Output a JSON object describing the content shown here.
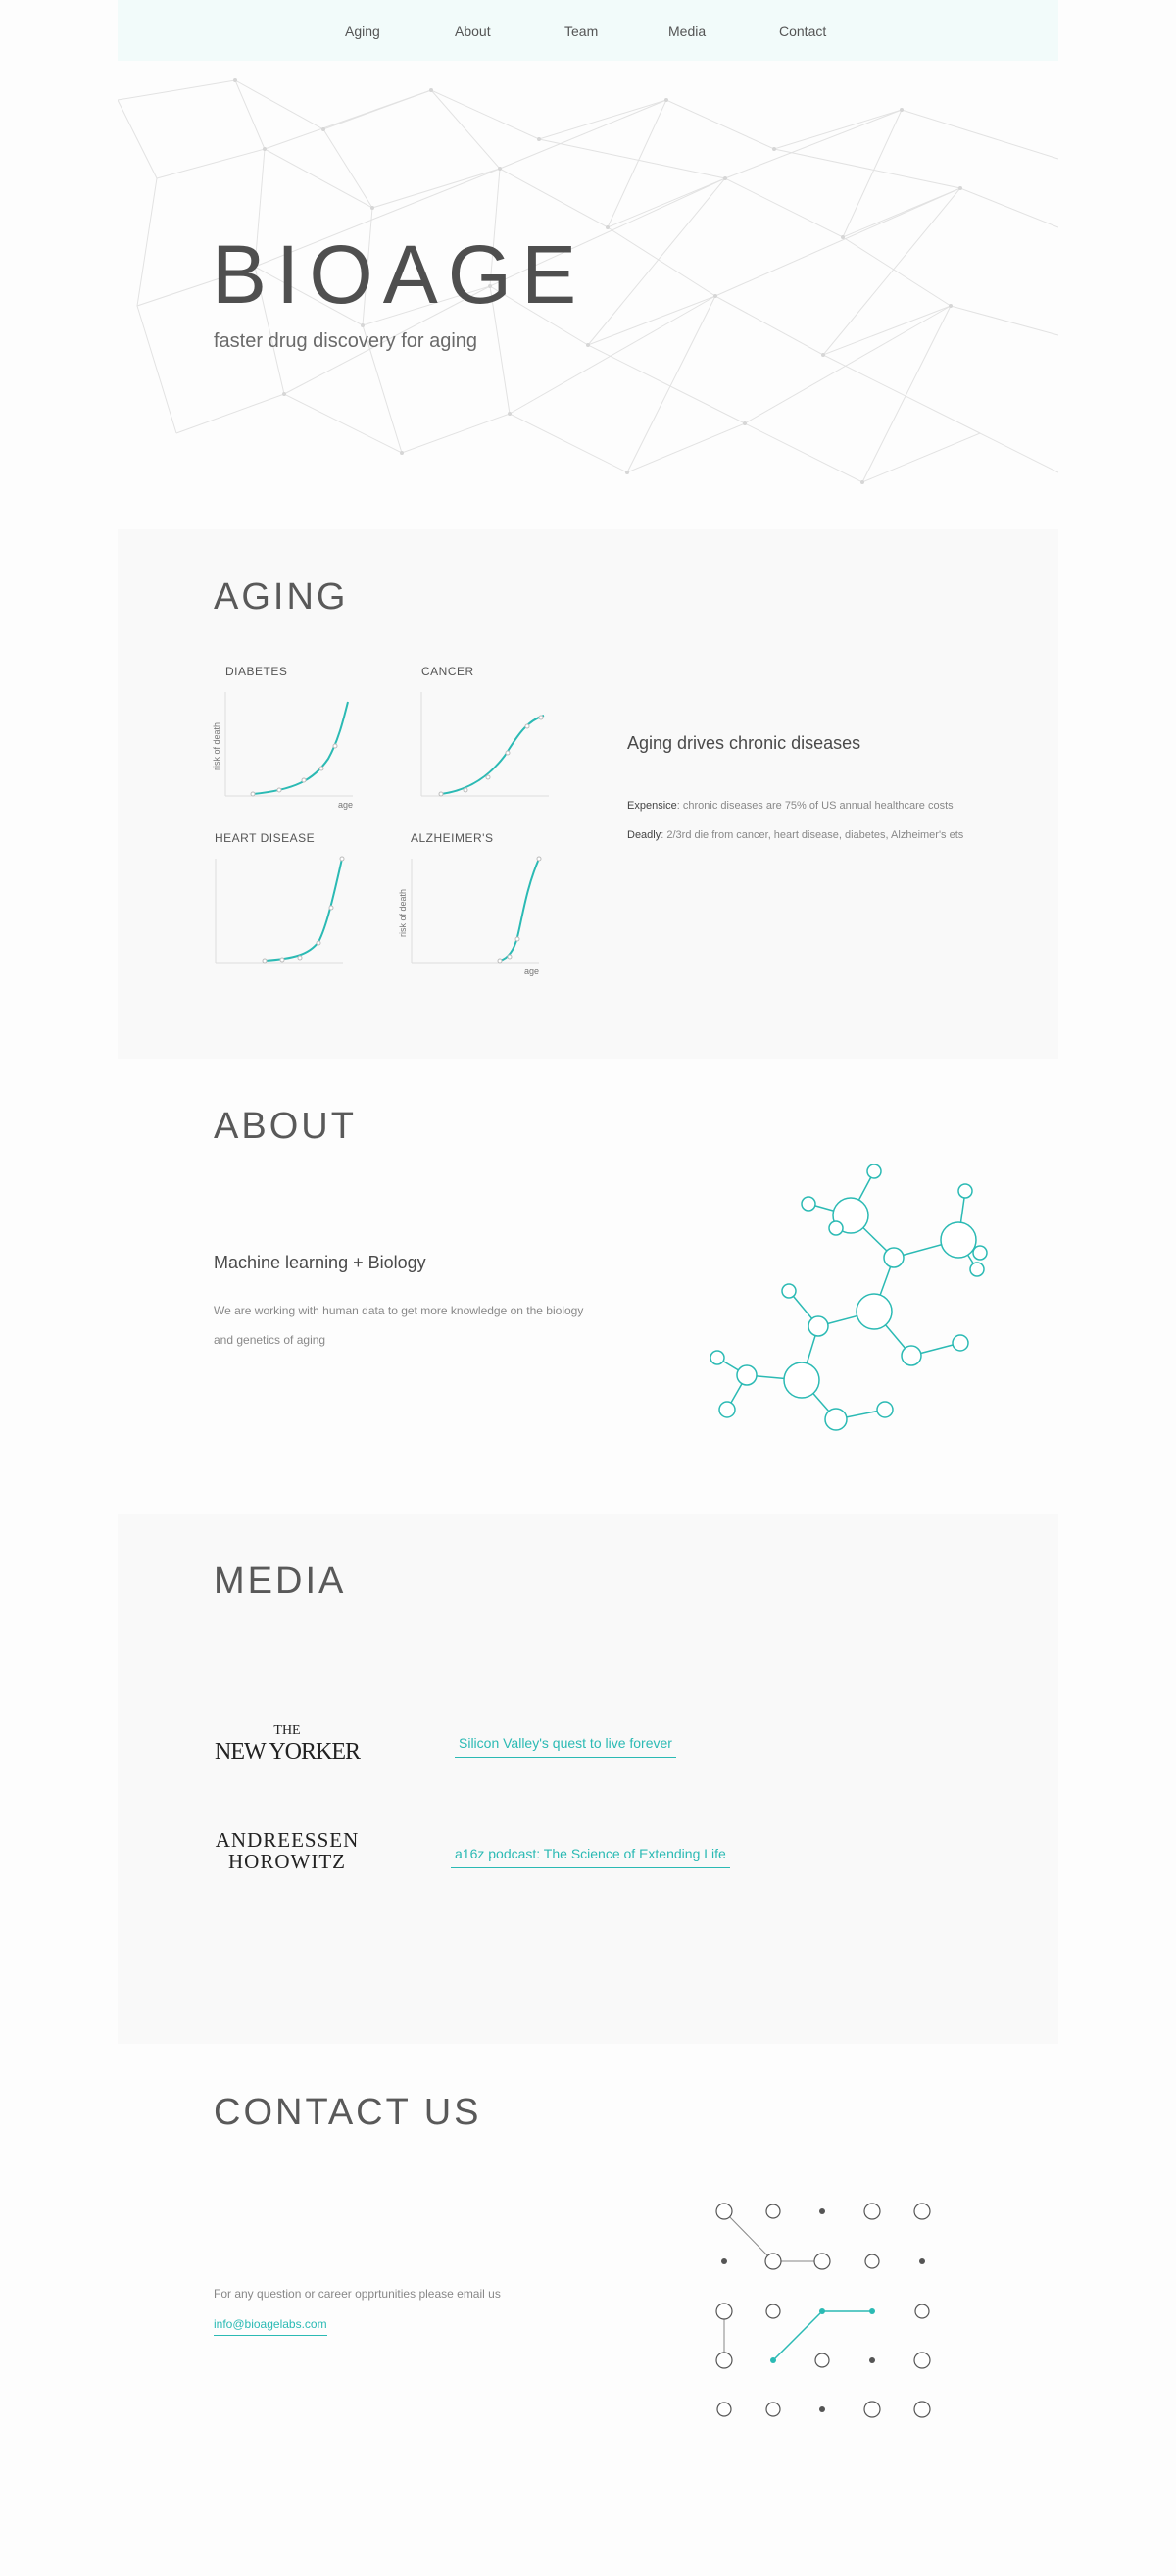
{
  "nav": {
    "items": [
      "Aging",
      "About",
      "Team",
      "Media",
      "Contact"
    ]
  },
  "hero": {
    "logo": "BIOAGE",
    "tagline": "faster drug discovery for aging"
  },
  "aging": {
    "title": "AGING",
    "heading": "Aging drives chronic diseases",
    "lines": [
      {
        "label": "Expensice",
        "text": ": chronic diseases are 75% of US annual healthcare costs"
      },
      {
        "label": "Deadly",
        "text": ": 2/3rd die from cancer, heart disease, diabetes, Alzheimer's ets"
      }
    ],
    "charts": [
      {
        "name": "DIABETES",
        "ylabel": "risk of death",
        "xlabel": "age"
      },
      {
        "name": "CANCER",
        "ylabel": "",
        "xlabel": ""
      },
      {
        "name": "HEART DISEASE",
        "ylabel": "",
        "xlabel": ""
      },
      {
        "name": "ALZHEIMER'S",
        "ylabel": "risk of death",
        "xlabel": "age"
      }
    ]
  },
  "about": {
    "title": "ABOUT",
    "heading": "Machine learning + Biology",
    "text": "We are working with human data to get more knowledge on the biology and genetics of aging"
  },
  "media": {
    "title": "MEDIA",
    "items": [
      {
        "logo_top": "THE",
        "logo_main": "NEW YORKER",
        "link": "Silicon Valley's quest to live forever"
      },
      {
        "logo_top": "ANDREESSEN",
        "logo_main": "HOROWITZ",
        "link": "a16z podcast: The Science of Extending Life"
      }
    ]
  },
  "contact": {
    "title": "CONTACT US",
    "text": "For any question or career opprtunities please email us",
    "email": "info@bioagelabs.com"
  },
  "colors": {
    "accent": "#2bbab4",
    "nav_bg": "#f2fbfa",
    "section_bg": "#f9f9f9"
  }
}
